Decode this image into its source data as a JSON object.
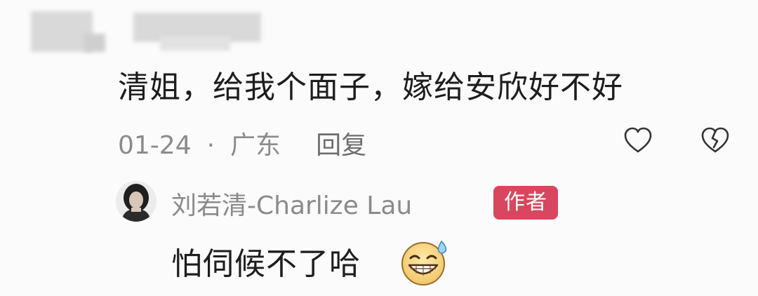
{
  "comment": {
    "text": "清姐，给我个面子，嫁给安欣好不好",
    "date": "01-24",
    "separator": "·",
    "location": "广东",
    "reply_label": "回复",
    "like_icon": "heart-outline-icon",
    "dislike_icon": "broken-heart-icon"
  },
  "reply": {
    "author": "刘若清-Charlize Lau",
    "badge": "作者",
    "text": "怕伺候不了哈",
    "emoji": "grinning-sweat-emoji",
    "badge_color": "#d9465f"
  },
  "colors": {
    "text_primary": "#1d1d1d",
    "text_secondary": "#8b8b8b",
    "background": "#fbfbfb"
  }
}
